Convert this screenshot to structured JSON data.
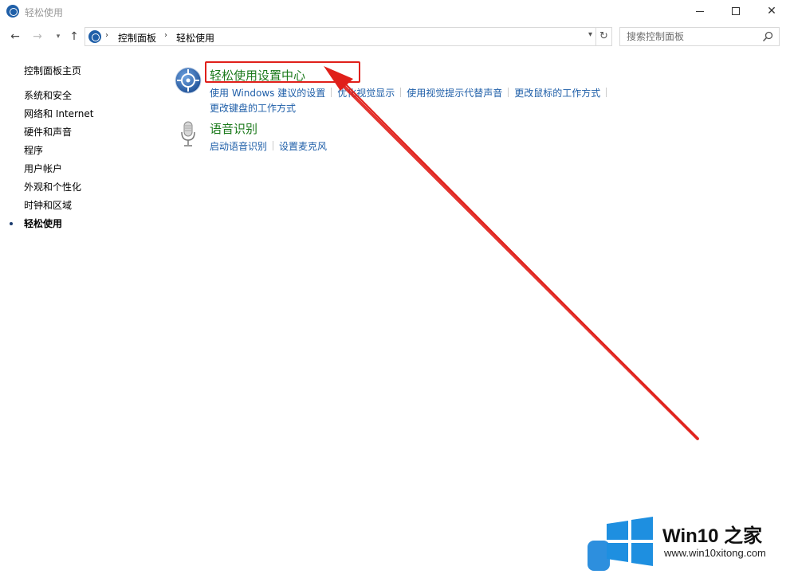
{
  "window": {
    "title": "轻松使用"
  },
  "address_bar": {
    "crumbs": [
      "控制面板",
      "轻松使用"
    ]
  },
  "search": {
    "placeholder": "搜索控制面板"
  },
  "left_nav": {
    "home": "控制面板主页",
    "items": [
      {
        "label": "系统和安全"
      },
      {
        "label": "网络和 Internet"
      },
      {
        "label": "硬件和声音"
      },
      {
        "label": "程序"
      },
      {
        "label": "用户帐户"
      },
      {
        "label": "外观和个性化"
      },
      {
        "label": "时钟和区域"
      },
      {
        "label": "轻松使用",
        "active": true
      }
    ]
  },
  "sections": [
    {
      "title": "轻松使用设置中心",
      "icon": "ease-of-access-icon",
      "links": [
        "使用 Windows 建议的设置",
        "优化视觉显示",
        "使用视觉提示代替声音",
        "更改鼠标的工作方式",
        "更改键盘的工作方式"
      ]
    },
    {
      "title": "语音识别",
      "icon": "microphone-icon",
      "links": [
        "启动语音识别",
        "设置麦克风"
      ]
    }
  ],
  "watermark": {
    "title": "Win10 之家",
    "url": "www.win10xitong.com"
  },
  "colors": {
    "section_title": "#1c7a1c",
    "link": "#1e5ea8",
    "annotation": "#e0201a"
  }
}
